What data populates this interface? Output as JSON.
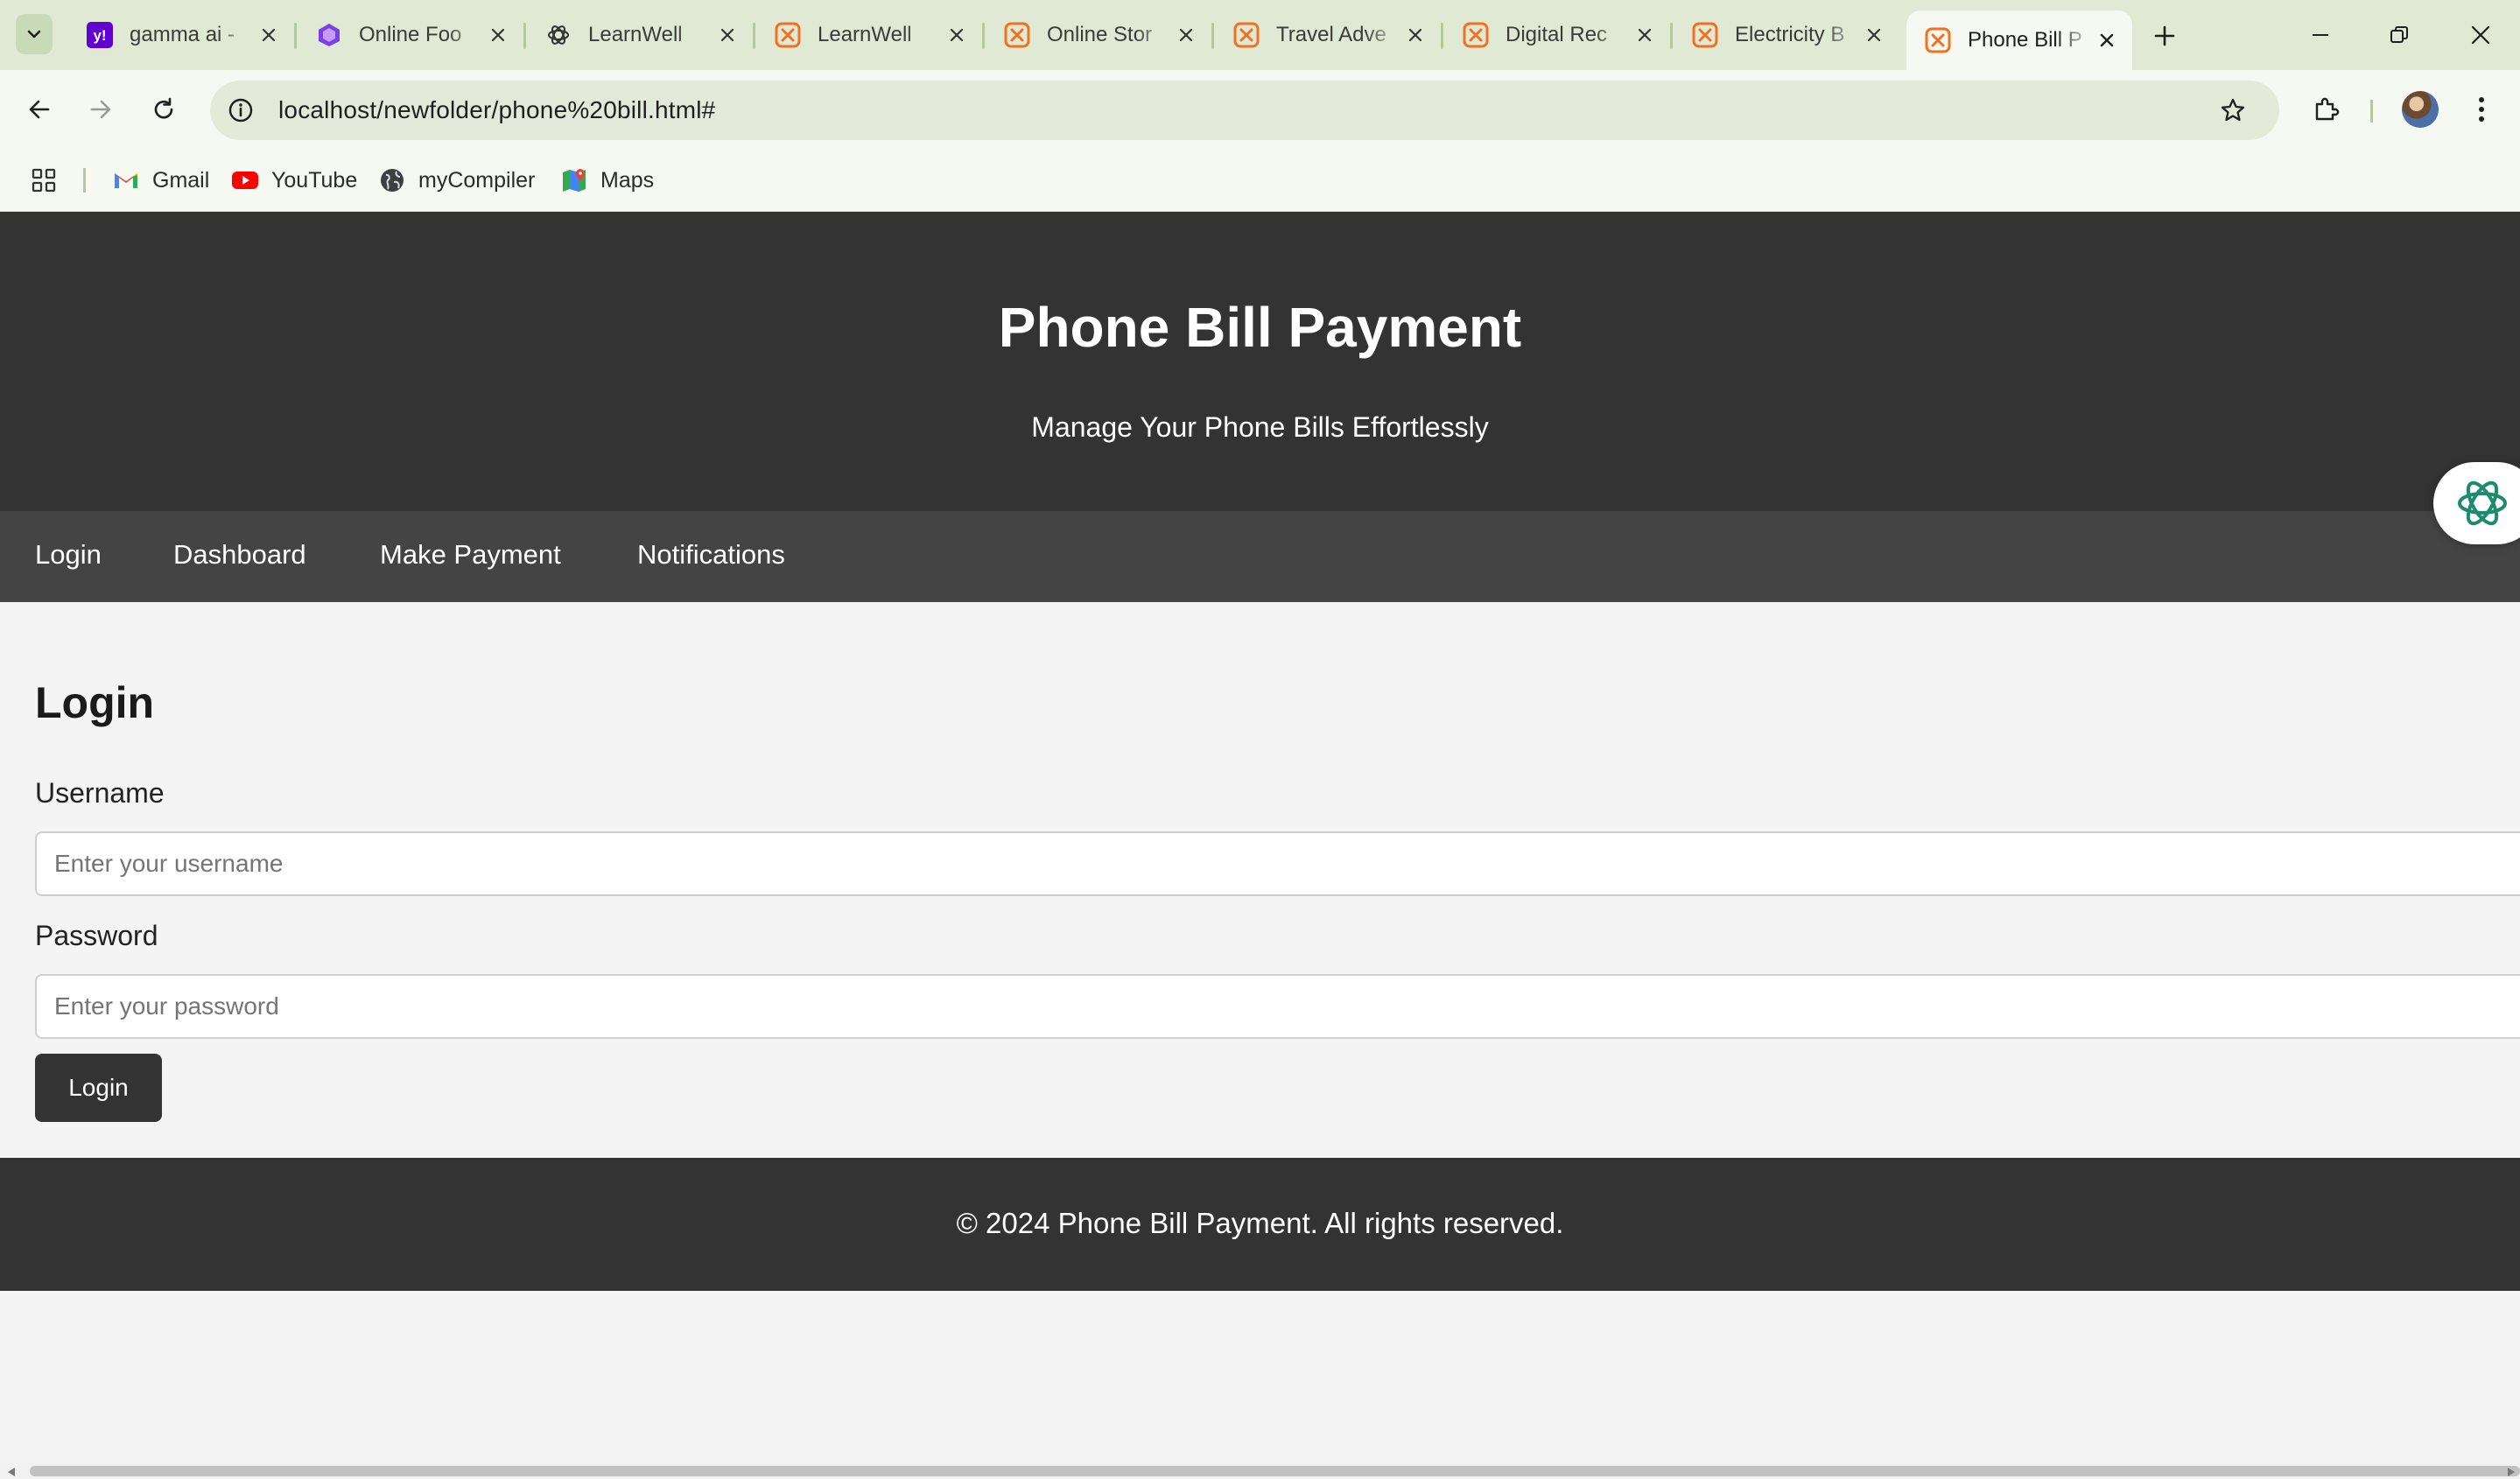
{
  "browser": {
    "tabs": [
      {
        "title": "gamma ai -",
        "favicon": "yahoo-icon",
        "active": false
      },
      {
        "title": "Online Foo",
        "favicon": "gamma-logo-icon",
        "active": false
      },
      {
        "title": "LearnWell",
        "favicon": "openai-icon",
        "active": false
      },
      {
        "title": "LearnWell",
        "favicon": "xampp-icon",
        "active": false
      },
      {
        "title": "Online Stor",
        "favicon": "xampp-icon",
        "active": false
      },
      {
        "title": "Travel Adve",
        "favicon": "xampp-icon",
        "active": false
      },
      {
        "title": "Digital Rec",
        "favicon": "xampp-icon",
        "active": false
      },
      {
        "title": "Electricity B",
        "favicon": "xampp-icon",
        "active": false
      },
      {
        "title": "Phone Bill P",
        "favicon": "xampp-icon",
        "active": true
      }
    ],
    "url": "localhost/newfolder/phone%20bill.html#",
    "bookmarks": [
      {
        "label": "Gmail",
        "icon": "gmail-icon"
      },
      {
        "label": "YouTube",
        "icon": "youtube-icon"
      },
      {
        "label": "myCompiler",
        "icon": "globe-icon"
      },
      {
        "label": "Maps",
        "icon": "maps-icon"
      }
    ],
    "colors": {
      "tabbar": "#dfe9d3",
      "toolbar": "#f6f9f1",
      "accent": "#b4c99d"
    }
  },
  "site": {
    "header": {
      "title": "Phone Bill Payment",
      "tagline": "Manage Your Phone Bills Effortlessly"
    },
    "nav": {
      "login": "Login",
      "dashboard": "Dashboard",
      "make_payment": "Make Payment",
      "notifications": "Notifications"
    },
    "login_form": {
      "heading": "Login",
      "username_label": "Username",
      "username_placeholder": "Enter your username",
      "password_label": "Password",
      "password_placeholder": "Enter your password",
      "submit_label": "Login"
    },
    "footer": {
      "text": "© 2024 Phone Bill Payment. All rights reserved."
    },
    "colors": {
      "header_bg": "#333333",
      "nav_bg": "#444444",
      "page_bg": "#f4f4f4",
      "button_bg": "#333333"
    }
  }
}
